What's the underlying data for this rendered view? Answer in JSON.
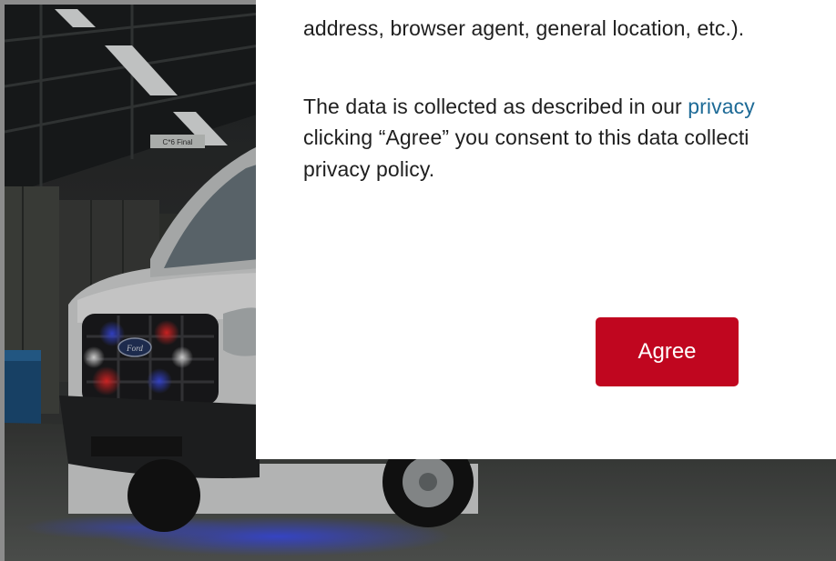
{
  "consent": {
    "intro_line_fragment": "address, browser agent, general location, etc.).",
    "consent_line1_prefix": "The data is collected as described in our ",
    "consent_link_fragment": "privacy",
    "consent_line2": "clicking “Agree” you consent to this data collecti",
    "consent_line3": "privacy policy.",
    "agree_label": "Agree"
  },
  "scene": {
    "sign_text": "C*6 Final",
    "vehicle_badge_text": "Ford"
  },
  "colors": {
    "agree_button": "#c0061f",
    "link": "#1d6a96",
    "modal_bg": "#ffffff",
    "text": "#1f1f1f"
  }
}
